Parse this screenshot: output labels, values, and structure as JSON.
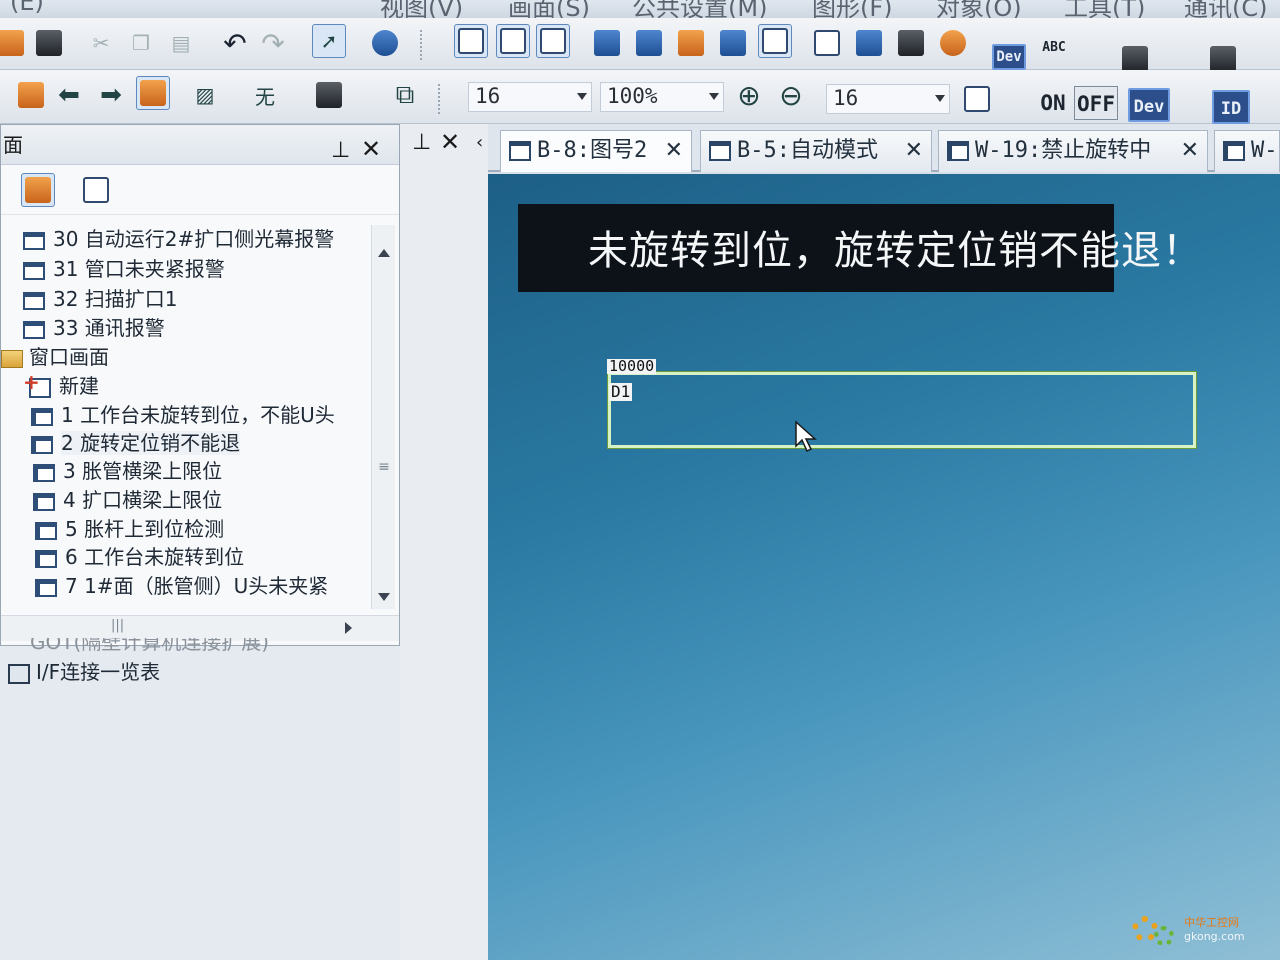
{
  "menu": {
    "items": [
      "(E)",
      "视图(V)",
      "画面(S)",
      "公共设置(M)",
      "图形(F)",
      "对象(O)",
      "工具(T)",
      "通讯(C)"
    ]
  },
  "toolbar2": {
    "line_style_label": "无",
    "font_size_1": "16",
    "zoom": "100%",
    "font_size_2": "16",
    "on_label": "ON",
    "off_label": "OFF",
    "dev_label": "Dev",
    "id_label": "ID",
    "dev_small_label": "Dev",
    "abc_label": "ABC"
  },
  "left_panel": {
    "title": "面",
    "items": [
      {
        "label": "30  自动运行2#扩口侧光幕报警",
        "icon": "base-screen-icon"
      },
      {
        "label": "31  管口未夹紧报警",
        "icon": "base-screen-icon"
      },
      {
        "label": "32  扫描扩口1",
        "icon": "base-screen-icon"
      },
      {
        "label": "33  通讯报警",
        "icon": "base-screen-icon"
      },
      {
        "label": "窗口画面",
        "icon": "folder-icon"
      },
      {
        "label": "新建",
        "icon": "new-screen-icon"
      },
      {
        "label": "1  工作台未旋转到位，不能U头",
        "icon": "window-screen-icon"
      },
      {
        "label": "2  旋转定位销不能退",
        "icon": "window-screen-icon"
      },
      {
        "label": "3  胀管横梁上限位",
        "icon": "window-screen-icon"
      },
      {
        "label": "4  扩口横梁上限位",
        "icon": "window-screen-icon"
      },
      {
        "label": "5  胀杆上到位检测",
        "icon": "window-screen-icon"
      },
      {
        "label": "6  工作台未旋转到位",
        "icon": "window-screen-icon"
      },
      {
        "label": "7  1#面（胀管侧）U头未夹紧",
        "icon": "window-screen-icon"
      }
    ],
    "below": {
      "partial_item": "GOT(隔壁计算机连接扩展)",
      "if_list": "I/F连接一览表"
    }
  },
  "tabs": [
    {
      "label": "B-8:图号2"
    },
    {
      "label": "B-5:自动模式"
    },
    {
      "label": "W-19:禁止旋转中"
    },
    {
      "label": "W-"
    }
  ],
  "canvas": {
    "banner_text": "未旋转到位，旋转定位销不能退！",
    "numeric_display": {
      "max_value": "10000",
      "device": "D1"
    },
    "colors": {
      "banner_bg": "#0d1218",
      "banner_text": "#f4f6f8",
      "canvas_bg_top": "#1d5f86",
      "frame": "#d7f2c4"
    }
  },
  "watermark": {
    "line1": "中华工控网",
    "line2": "gkong.com"
  }
}
